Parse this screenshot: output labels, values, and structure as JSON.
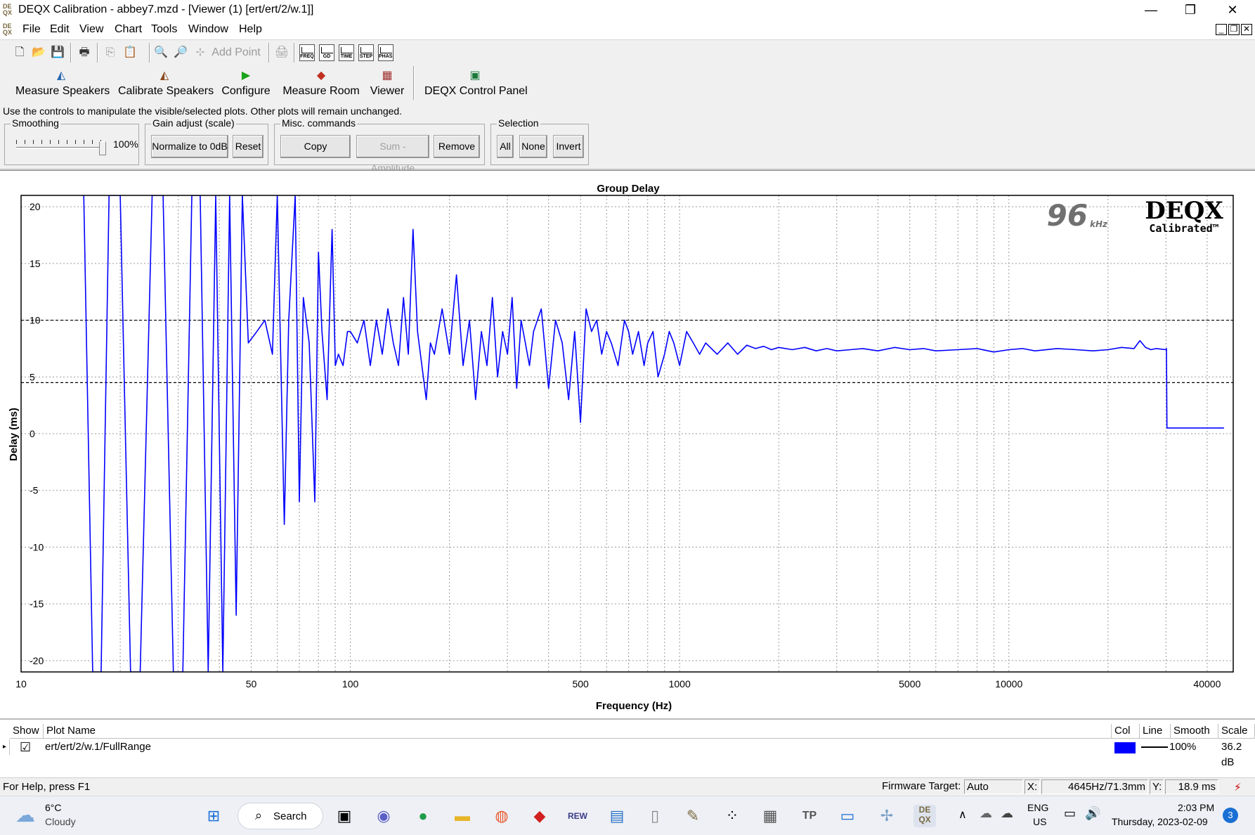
{
  "window": {
    "title": "DEQX Calibration - abbey7.mzd - [Viewer (1) [ert/ert/2/w.1]]",
    "app_icon": "deqx-logo-icon",
    "minimize": "—",
    "restore": "❐",
    "close": "✕"
  },
  "menu": {
    "items": [
      "File",
      "Edit",
      "View",
      "Chart",
      "Tools",
      "Window",
      "Help"
    ]
  },
  "toolbar": {
    "add_point": "Add Point",
    "chip_labels": [
      "FREQ",
      "GD",
      "TIME",
      "STEP",
      "PHASE"
    ]
  },
  "main_toolbar": {
    "buttons": [
      "Measure Speakers",
      "Calibrate Speakers",
      "Configure",
      "Measure Room",
      "Viewer",
      "DEQX Control Panel"
    ]
  },
  "controls": {
    "hint": "Use the controls to manipulate the visible/selected plots.  Other plots will remain unchanged.",
    "smoothing": {
      "legend": "Smoothing",
      "value": "100%",
      "level": 1.0
    },
    "gain": {
      "legend": "Gain adjust (scale)",
      "normalize": "Normalize to 0dB",
      "reset": "Reset"
    },
    "misc": {
      "legend": "Misc. commands",
      "copy": "Copy",
      "sum": "Sum - Amplitude",
      "remove": "Remove"
    },
    "selection": {
      "legend": "Selection",
      "all": "All",
      "none": "None",
      "invert": "Invert"
    }
  },
  "chart_data": {
    "type": "line",
    "title": "Group Delay",
    "xlabel": "Frequency (Hz)",
    "ylabel": "Delay (ms)",
    "x_scale": "log",
    "xlim": [
      10,
      48000
    ],
    "ylim": [
      -21,
      21
    ],
    "x_ticks": [
      10,
      50,
      100,
      500,
      1000,
      5000,
      10000,
      40000
    ],
    "y_ticks": [
      20,
      15,
      10,
      5,
      0,
      -5,
      -10,
      -15,
      -20
    ],
    "grid": true,
    "dashed_lines": [
      10,
      4.5
    ],
    "logo": {
      "rate": "96",
      "unit": "kHz",
      "brand": "DEQX",
      "sub": "Calibrated™"
    },
    "series": [
      {
        "color": "#0000ff",
        "x": [
          15.5,
          16.5,
          17.5,
          18.5,
          20,
          21.5,
          23,
          25,
          27,
          29,
          31,
          33,
          35,
          37,
          39,
          41,
          43,
          45,
          47,
          49,
          52,
          55,
          58,
          60,
          63,
          65,
          68,
          70,
          72,
          75,
          78,
          80,
          82,
          85,
          88,
          90,
          92,
          95,
          98,
          100,
          105,
          110,
          115,
          120,
          125,
          130,
          135,
          140,
          145,
          150,
          155,
          160,
          170,
          175,
          180,
          190,
          200,
          210,
          220,
          230,
          240,
          250,
          260,
          270,
          280,
          290,
          300,
          310,
          320,
          330,
          340,
          350,
          360,
          380,
          400,
          420,
          440,
          460,
          480,
          500,
          520,
          540,
          560,
          580,
          600,
          620,
          650,
          680,
          700,
          720,
          750,
          780,
          800,
          830,
          860,
          900,
          930,
          960,
          1000,
          1050,
          1100,
          1150,
          1200,
          1300,
          1400,
          1500,
          1600,
          1700,
          1800,
          1900,
          2000,
          2200,
          2400,
          2600,
          2800,
          3000,
          3300,
          3600,
          4000,
          4500,
          5000,
          5500,
          6000,
          7000,
          8000,
          9000,
          10000,
          11000,
          12000,
          14000,
          16000,
          18000,
          20000,
          22000,
          24000,
          25000,
          26000,
          27000,
          28000,
          30000,
          30100,
          30200,
          40000,
          45000
        ],
        "y": [
          21,
          -21,
          -21,
          21,
          21,
          -21,
          -21,
          21,
          21,
          -21,
          -21,
          21,
          21,
          -21,
          21,
          -21,
          21,
          -16,
          21,
          8,
          9,
          10,
          7,
          21,
          -8,
          10,
          21,
          -6,
          12,
          8,
          -6,
          16,
          9,
          3,
          18,
          6,
          7,
          6,
          9,
          9,
          8,
          10,
          6,
          10,
          7,
          11,
          8,
          6,
          12,
          7,
          18,
          9,
          3,
          8,
          7,
          11,
          7,
          14,
          6,
          10,
          3,
          9,
          6,
          12,
          5,
          9,
          7,
          12,
          4,
          10,
          8,
          6,
          9,
          11,
          4,
          10,
          8,
          3,
          9,
          1,
          11,
          9,
          10,
          7,
          9,
          8,
          6,
          10,
          9,
          7,
          9,
          6,
          8,
          9,
          5,
          7,
          9,
          8,
          6,
          9,
          8,
          7,
          8,
          7,
          8,
          7,
          7.8,
          7.5,
          7.7,
          7.4,
          7.6,
          7.4,
          7.6,
          7.3,
          7.5,
          7.3,
          7.4,
          7.5,
          7.3,
          7.6,
          7.4,
          7.5,
          7.3,
          7.4,
          7.5,
          7.2,
          7.4,
          7.5,
          7.3,
          7.5,
          7.4,
          7.3,
          7.4,
          7.6,
          7.5,
          8.2,
          7.6,
          7.4,
          7.5,
          7.4,
          7.5,
          0.5,
          0.5,
          0.5
        ]
      }
    ]
  },
  "plots_table": {
    "headers": [
      "Show",
      "Plot Name",
      "Col",
      "Line",
      "Smooth",
      "Scale"
    ],
    "rows": [
      {
        "show": "☑",
        "name": "ert/ert/2/w.1/FullRange",
        "color": "#0000ff",
        "smooth": "100%",
        "scale": "36.2 dB"
      }
    ]
  },
  "status": {
    "help": "For Help, press F1",
    "firmware_label": "Firmware Target:",
    "firmware_value": "Auto",
    "x_label": "X:",
    "x_value": "4645Hz/71.3mm",
    "y_label": "Y:",
    "y_value": "18.9 ms"
  },
  "taskbar": {
    "weather_temp": "6°C",
    "weather_desc": "Cloudy",
    "search": "Search",
    "lang1": "ENG",
    "lang2": "US",
    "time": "2:03 PM",
    "date": "Thursday, 2023-02-09",
    "notif_count": "3"
  }
}
